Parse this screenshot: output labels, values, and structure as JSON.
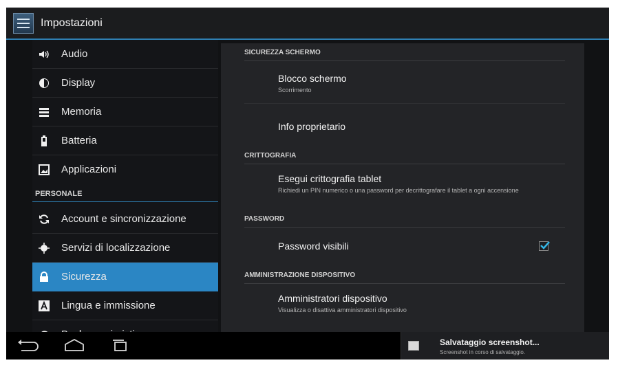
{
  "titlebar": {
    "title": "Impostazioni"
  },
  "sidebar": {
    "items_top": [
      {
        "label": "Audio",
        "icon": "volume-icon"
      },
      {
        "label": "Display",
        "icon": "brightness-icon"
      },
      {
        "label": "Memoria",
        "icon": "storage-icon"
      },
      {
        "label": "Batteria",
        "icon": "battery-icon"
      },
      {
        "label": "Applicazioni",
        "icon": "apps-icon"
      }
    ],
    "personal_header": "PERSONALE",
    "items_personal": [
      {
        "label": "Account e sincronizzazione",
        "icon": "sync-icon"
      },
      {
        "label": "Servizi di localizzazione",
        "icon": "location-icon"
      },
      {
        "label": "Sicurezza",
        "icon": "lock-icon",
        "selected": true
      },
      {
        "label": "Lingua e immissione",
        "icon": "language-icon"
      },
      {
        "label": "Backup e ripristino",
        "icon": "backup-icon"
      }
    ]
  },
  "content": {
    "sections": [
      {
        "header": "SICUREZZA SCHERMO"
      },
      {
        "header": "CRITTOGRAFIA"
      },
      {
        "header": "PASSWORD"
      },
      {
        "header": "AMMINISTRAZIONE DISPOSITIVO"
      }
    ],
    "rows": {
      "screen_lock": {
        "title": "Blocco schermo",
        "summary": "Scorrimento"
      },
      "owner_info": {
        "title": "Info proprietario"
      },
      "encrypt": {
        "title": "Esegui crittografia tablet",
        "summary": "Richiedi un PIN numerico o una password per decrittografare il tablet a ogni accensione"
      },
      "visible_passwords": {
        "title": "Password visibili",
        "checked": true
      },
      "device_admins": {
        "title": "Amministratori dispositivo",
        "summary": "Visualizza o disattiva amministratori dispositivo"
      }
    }
  },
  "notification": {
    "title": "Salvataggio screenshot...",
    "subtitle": "Screenshot in corso di salvataggio."
  },
  "colors": {
    "accent": "#2b86c4",
    "background": "#111214",
    "content_panel": "#232427"
  }
}
